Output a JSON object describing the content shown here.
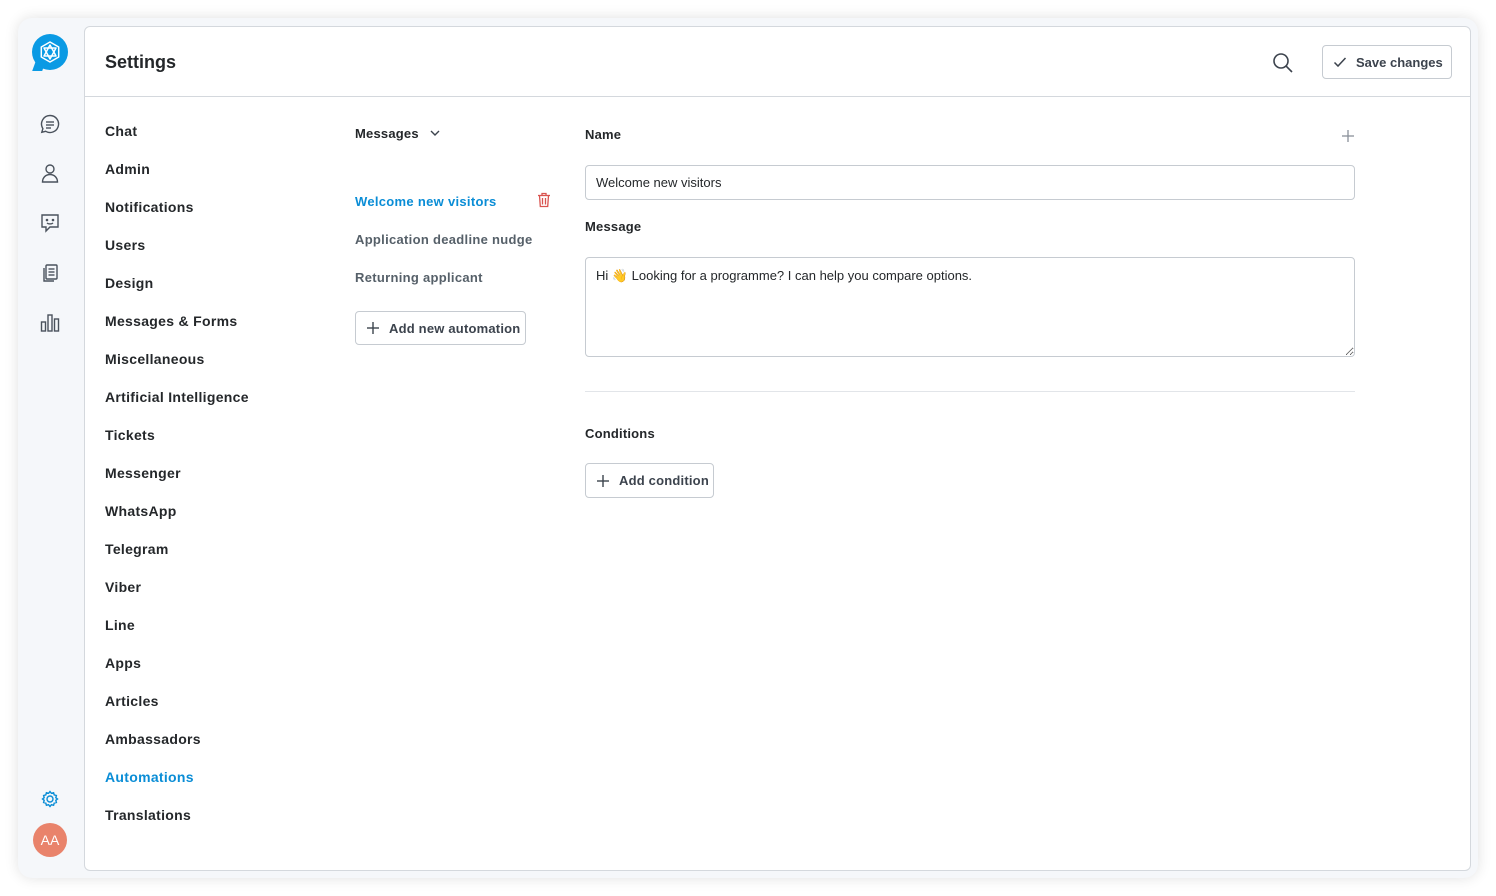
{
  "header": {
    "title": "Settings",
    "save_label": "Save changes"
  },
  "avatar": {
    "initials": "AA",
    "color": "#e9836b"
  },
  "colors": {
    "accent": "#0a8dd6",
    "danger": "#d9534f"
  },
  "rail_icons": [
    "chat-bubble-icon",
    "user-icon",
    "chatbot-icon",
    "documents-icon",
    "bar-chart-icon",
    "gear-icon"
  ],
  "nav": {
    "items": [
      "Chat",
      "Admin",
      "Notifications",
      "Users",
      "Design",
      "Messages & Forms",
      "Miscellaneous",
      "Artificial Intelligence",
      "Tickets",
      "Messenger",
      "WhatsApp",
      "Telegram",
      "Viber",
      "Line",
      "Apps",
      "Articles",
      "Ambassadors",
      "Automations",
      "Translations"
    ],
    "active": "Automations"
  },
  "automations": {
    "dropdown_label": "Messages",
    "items": [
      "Welcome new visitors",
      "Application deadline nudge",
      "Returning applicant"
    ],
    "active": "Welcome new visitors",
    "add_label": "Add new automation"
  },
  "form": {
    "name_label": "Name",
    "name_value": "Welcome new visitors",
    "message_label": "Message",
    "message_value": "Hi 👋 Looking for a programme? I can help you compare options.",
    "conditions_label": "Conditions",
    "add_condition_label": "Add condition"
  }
}
